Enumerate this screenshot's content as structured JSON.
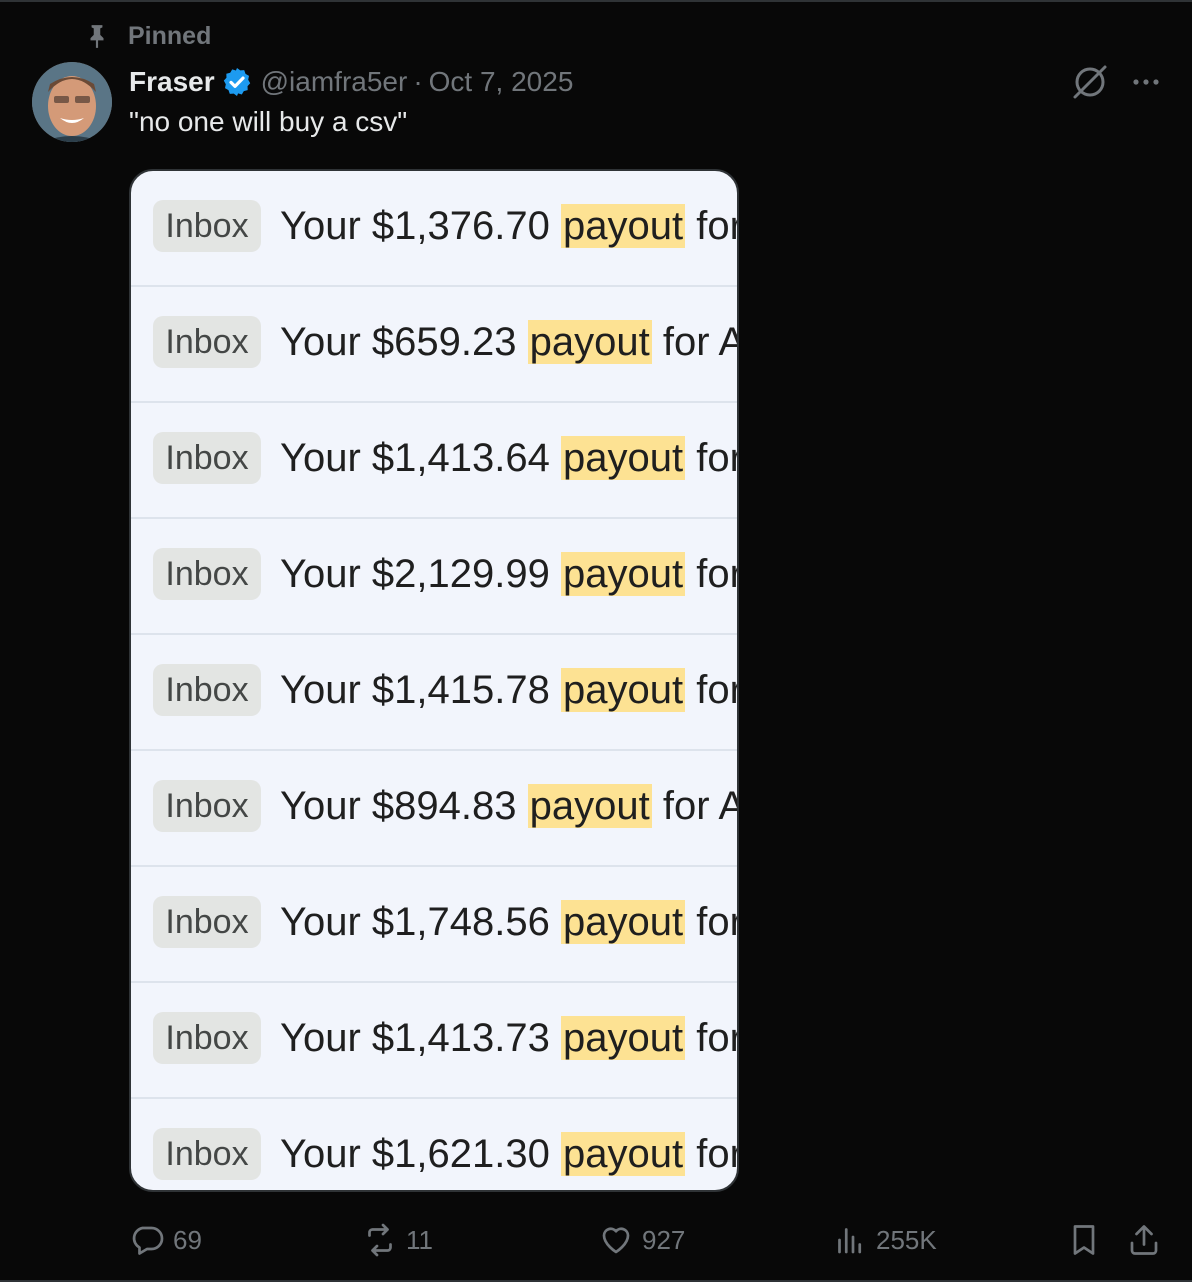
{
  "pinned": {
    "label": "Pinned",
    "icon": "pin-icon"
  },
  "author": {
    "name": "Fraser",
    "handle": "@iamfra5er",
    "separator": "·",
    "date": "Oct 7, 2025",
    "verified_color": "#1d9bf0"
  },
  "tweet": {
    "text": "\"no one will buy a csv\""
  },
  "emails": [
    {
      "label": "Inbox",
      "prefix": "Your $1,376.70 ",
      "highlight": "payout",
      "suffix": " for"
    },
    {
      "label": "Inbox",
      "prefix": "Your $659.23 ",
      "highlight": "payout",
      "suffix": " for A"
    },
    {
      "label": "Inbox",
      "prefix": "Your $1,413.64 ",
      "highlight": "payout",
      "suffix": " for"
    },
    {
      "label": "Inbox",
      "prefix": "Your $2,129.99 ",
      "highlight": "payout",
      "suffix": " for"
    },
    {
      "label": "Inbox",
      "prefix": "Your $1,415.78 ",
      "highlight": "payout",
      "suffix": " for"
    },
    {
      "label": "Inbox",
      "prefix": "Your $894.83 ",
      "highlight": "payout",
      "suffix": " for A"
    },
    {
      "label": "Inbox",
      "prefix": "Your $1,748.56 ",
      "highlight": "payout",
      "suffix": " for"
    },
    {
      "label": "Inbox",
      "prefix": "Your $1,413.73 ",
      "highlight": "payout",
      "suffix": " for"
    },
    {
      "label": "Inbox",
      "prefix": "Your $1,621.30 ",
      "highlight": "payout",
      "suffix": " for"
    }
  ],
  "actions": {
    "replies": "69",
    "reposts": "11",
    "likes": "927",
    "views": "255K"
  },
  "colors": {
    "highlight": "#fde293",
    "muted": "#71767b",
    "text": "#e7e9ea"
  }
}
